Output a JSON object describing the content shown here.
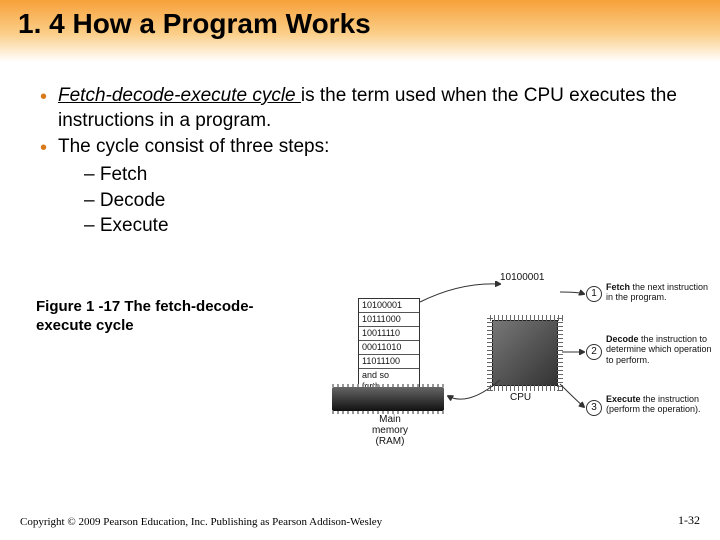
{
  "title": "1. 4 How a Program Works",
  "bullets": {
    "b1_term": "Fetch-decode-execute cycle ",
    "b1_rest": "is the term used when the CPU executes the instructions in a program.",
    "b2": "The cycle consist of three steps:",
    "sub1": "Fetch",
    "sub2": "Decode",
    "sub3": "Execute"
  },
  "figure": {
    "caption": "Figure 1 -17  The fetch-decode-execute cycle",
    "memory_rows": [
      "10100001",
      "10111000",
      "10011110",
      "00011010",
      "11011100",
      "and so forth..."
    ],
    "cpu_binary": "10100001",
    "ram_label": "Main memory\n(RAM)",
    "cpu_label": "CPU",
    "steps": [
      {
        "n": "1",
        "bold": "Fetch",
        "text": " the next instruction in the program."
      },
      {
        "n": "2",
        "bold": "Decode",
        "text": " the instruction to determine which operation to perform."
      },
      {
        "n": "3",
        "bold": "Execute",
        "text": " the instruction (perform the operation)."
      }
    ]
  },
  "footer": "Copyright © 2009 Pearson Education, Inc. Publishing as Pearson Addison-Wesley",
  "pagenum": "1-32"
}
